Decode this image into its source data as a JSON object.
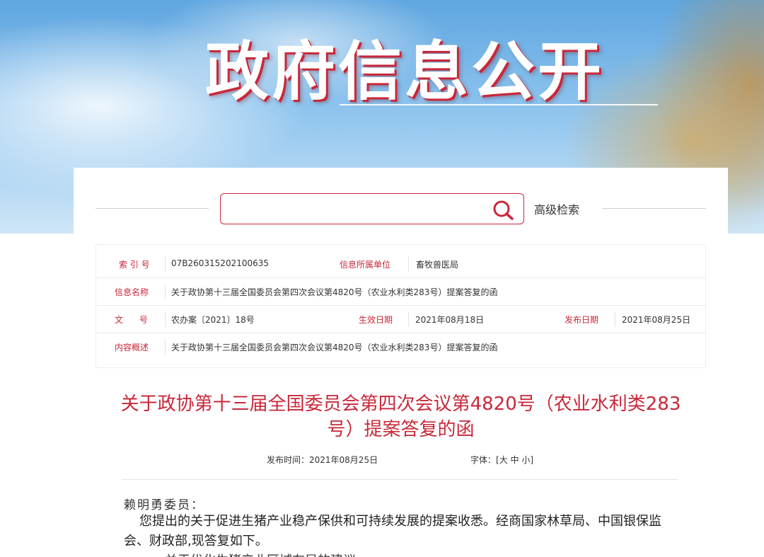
{
  "banner": {
    "title": "政府信息公开"
  },
  "search": {
    "value": "",
    "placeholder": "",
    "advanced_label": "高级检索"
  },
  "meta": {
    "index_label": "索 引 号",
    "index_value": "07B260315202100635",
    "unit_label": "信息所属单位",
    "unit_value": "畜牧兽医局",
    "name_label": "信息名称",
    "name_value": "关于政协第十三届全国委员会第四次会议第4820号（农业水利类283号）提案答复的函",
    "doc_label": "文      号",
    "doc_value": "农办案〔2021〕18号",
    "effective_label": "生效日期",
    "effective_value": "2021年08月18日",
    "publish_label": "发布日期",
    "publish_value": "2021年08月25日",
    "summary_label": "内容概述",
    "summary_value": "关于政协第十三届全国委员会第四次会议第4820号（农业水利类283号）提案答复的函"
  },
  "article": {
    "title": "关于政协第十三届全国委员会第四次会议第4820号（农业水利类283号）提案答复的函",
    "publish_time_label": "发布时间：2021年08月25日",
    "font_label": "字体：",
    "font_open": "[",
    "font_large": "大",
    "font_medium": "中",
    "font_small": "小",
    "font_close": "]",
    "salutation": "赖明勇委员：",
    "paragraph1": "您提出的关于促进生猪产业稳产保供和可持续发展的提案收悉。经商国家林草局、中国银保监会、财政部,现答复如下。",
    "paragraph2": "一、关于优化生猪产业区域布局的建议"
  },
  "colors": {
    "accent": "#c8283a",
    "sky": "#8cc3ee"
  }
}
